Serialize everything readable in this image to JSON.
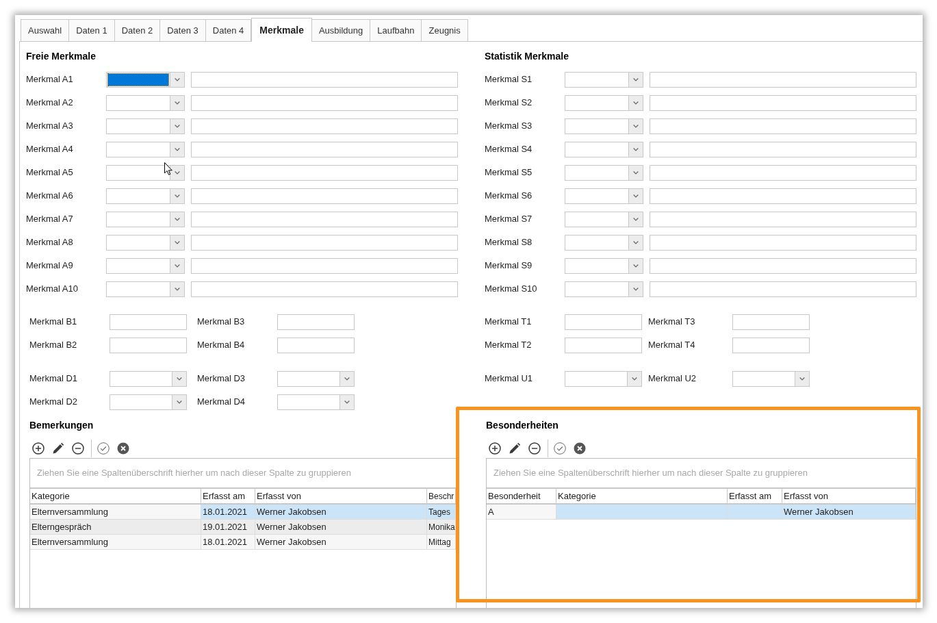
{
  "tabs": [
    {
      "label": "Auswahl",
      "selected": false
    },
    {
      "label": "Daten 1",
      "selected": false
    },
    {
      "label": "Daten 2",
      "selected": false
    },
    {
      "label": "Daten 3",
      "selected": false
    },
    {
      "label": "Daten 4",
      "selected": false
    },
    {
      "label": "Merkmale",
      "selected": true
    },
    {
      "label": "Ausbildung",
      "selected": false
    },
    {
      "label": "Laufbahn",
      "selected": false
    },
    {
      "label": "Zeugnis",
      "selected": false
    }
  ],
  "freie_merkmale": {
    "title": "Freie Merkmale",
    "rows": [
      {
        "label": "Merkmal A1",
        "highlighted": true
      },
      {
        "label": "Merkmal A2",
        "highlighted": false
      },
      {
        "label": "Merkmal A3",
        "highlighted": false
      },
      {
        "label": "Merkmal A4",
        "highlighted": false
      },
      {
        "label": "Merkmal A5",
        "highlighted": false
      },
      {
        "label": "Merkmal A6",
        "highlighted": false
      },
      {
        "label": "Merkmal A7",
        "highlighted": false
      },
      {
        "label": "Merkmal A8",
        "highlighted": false
      },
      {
        "label": "Merkmal A9",
        "highlighted": false
      },
      {
        "label": "Merkmal A10",
        "highlighted": false
      }
    ],
    "groups": [
      {
        "rows": [
          {
            "fields": [
              {
                "label": "Merkmal B1",
                "kind": "text"
              },
              {
                "label": "Merkmal B3",
                "kind": "text"
              }
            ]
          },
          {
            "fields": [
              {
                "label": "Merkmal B2",
                "kind": "text"
              },
              {
                "label": "Merkmal B4",
                "kind": "text"
              }
            ]
          }
        ]
      },
      {
        "rows": [
          {
            "fields": [
              {
                "label": "Merkmal D1",
                "kind": "dropdown"
              },
              {
                "label": "Merkmal D3",
                "kind": "dropdown"
              }
            ]
          },
          {
            "fields": [
              {
                "label": "Merkmal D2",
                "kind": "dropdown"
              },
              {
                "label": "Merkmal D4",
                "kind": "dropdown"
              }
            ]
          }
        ]
      }
    ]
  },
  "statistik_merkmale": {
    "title": "Statistik Merkmale",
    "rows": [
      {
        "label": "Merkmal S1",
        "highlighted": false
      },
      {
        "label": "Merkmal S2",
        "highlighted": false
      },
      {
        "label": "Merkmal S3",
        "highlighted": false
      },
      {
        "label": "Merkmal S4",
        "highlighted": false
      },
      {
        "label": "Merkmal S5",
        "highlighted": false
      },
      {
        "label": "Merkmal S6",
        "highlighted": false
      },
      {
        "label": "Merkmal S7",
        "highlighted": false
      },
      {
        "label": "Merkmal S8",
        "highlighted": false
      },
      {
        "label": "Merkmal S9",
        "highlighted": false
      },
      {
        "label": "Merkmal S10",
        "highlighted": false
      }
    ],
    "groups": [
      {
        "rows": [
          {
            "fields": [
              {
                "label": "Merkmal T1",
                "kind": "text"
              },
              {
                "label": "Merkmal T3",
                "kind": "text"
              }
            ]
          },
          {
            "fields": [
              {
                "label": "Merkmal T2",
                "kind": "text"
              },
              {
                "label": "Merkmal T4",
                "kind": "text"
              }
            ]
          }
        ]
      },
      {
        "rows": [
          {
            "fields": [
              {
                "label": "Merkmal U1",
                "kind": "dropdown"
              },
              {
                "label": "Merkmal U2",
                "kind": "dropdown"
              }
            ]
          }
        ]
      }
    ]
  },
  "bemerkungen": {
    "title": "Bemerkungen",
    "group_prompt": "Ziehen Sie eine Spaltenüberschrift hierher um nach dieser Spalte zu gruppieren",
    "columns": [
      "Kategorie",
      "Erfasst am",
      "Erfasst von",
      "Beschr"
    ],
    "rows": [
      {
        "selected": true,
        "cells": [
          "Elternversammlung",
          "18.01.2021",
          "Werner Jakobsen",
          "Tages"
        ]
      },
      {
        "selected": false,
        "cells": [
          "Elterngespräch",
          "19.01.2021",
          "Werner Jakobsen",
          "Monika"
        ]
      },
      {
        "selected": false,
        "cells": [
          "Elternversammlung",
          "18.01.2021",
          "Werner Jakobsen",
          "Mittag"
        ]
      }
    ]
  },
  "besonderheiten": {
    "title": "Besonderheiten",
    "highlighted": true,
    "group_prompt": "Ziehen Sie eine Spaltenüberschrift hierher um nach dieser Spalte zu gruppieren",
    "columns": [
      "Besonderheit",
      "Kategorie",
      "Erfasst am",
      "Erfasst von"
    ],
    "rows": [
      {
        "selected": true,
        "cells": [
          "A",
          null,
          null,
          "Werner Jakobsen"
        ]
      }
    ]
  }
}
